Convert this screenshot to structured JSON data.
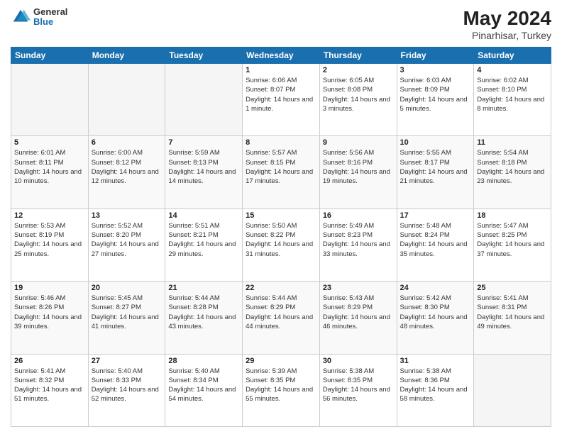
{
  "logo": {
    "general": "General",
    "blue": "Blue"
  },
  "title": "May 2024",
  "subtitle": "Pinarhisar, Turkey",
  "days_header": [
    "Sunday",
    "Monday",
    "Tuesday",
    "Wednesday",
    "Thursday",
    "Friday",
    "Saturday"
  ],
  "weeks": [
    {
      "shade": false,
      "days": [
        {
          "num": "",
          "empty": true,
          "info": ""
        },
        {
          "num": "",
          "empty": true,
          "info": ""
        },
        {
          "num": "",
          "empty": true,
          "info": ""
        },
        {
          "num": "1",
          "empty": false,
          "sunrise": "Sunrise: 6:06 AM",
          "sunset": "Sunset: 8:07 PM",
          "daylight": "Daylight: 14 hours and 1 minute."
        },
        {
          "num": "2",
          "empty": false,
          "sunrise": "Sunrise: 6:05 AM",
          "sunset": "Sunset: 8:08 PM",
          "daylight": "Daylight: 14 hours and 3 minutes."
        },
        {
          "num": "3",
          "empty": false,
          "sunrise": "Sunrise: 6:03 AM",
          "sunset": "Sunset: 8:09 PM",
          "daylight": "Daylight: 14 hours and 5 minutes."
        },
        {
          "num": "4",
          "empty": false,
          "sunrise": "Sunrise: 6:02 AM",
          "sunset": "Sunset: 8:10 PM",
          "daylight": "Daylight: 14 hours and 8 minutes."
        }
      ]
    },
    {
      "shade": true,
      "days": [
        {
          "num": "5",
          "empty": false,
          "sunrise": "Sunrise: 6:01 AM",
          "sunset": "Sunset: 8:11 PM",
          "daylight": "Daylight: 14 hours and 10 minutes."
        },
        {
          "num": "6",
          "empty": false,
          "sunrise": "Sunrise: 6:00 AM",
          "sunset": "Sunset: 8:12 PM",
          "daylight": "Daylight: 14 hours and 12 minutes."
        },
        {
          "num": "7",
          "empty": false,
          "sunrise": "Sunrise: 5:59 AM",
          "sunset": "Sunset: 8:13 PM",
          "daylight": "Daylight: 14 hours and 14 minutes."
        },
        {
          "num": "8",
          "empty": false,
          "sunrise": "Sunrise: 5:57 AM",
          "sunset": "Sunset: 8:15 PM",
          "daylight": "Daylight: 14 hours and 17 minutes."
        },
        {
          "num": "9",
          "empty": false,
          "sunrise": "Sunrise: 5:56 AM",
          "sunset": "Sunset: 8:16 PM",
          "daylight": "Daylight: 14 hours and 19 minutes."
        },
        {
          "num": "10",
          "empty": false,
          "sunrise": "Sunrise: 5:55 AM",
          "sunset": "Sunset: 8:17 PM",
          "daylight": "Daylight: 14 hours and 21 minutes."
        },
        {
          "num": "11",
          "empty": false,
          "sunrise": "Sunrise: 5:54 AM",
          "sunset": "Sunset: 8:18 PM",
          "daylight": "Daylight: 14 hours and 23 minutes."
        }
      ]
    },
    {
      "shade": false,
      "days": [
        {
          "num": "12",
          "empty": false,
          "sunrise": "Sunrise: 5:53 AM",
          "sunset": "Sunset: 8:19 PM",
          "daylight": "Daylight: 14 hours and 25 minutes."
        },
        {
          "num": "13",
          "empty": false,
          "sunrise": "Sunrise: 5:52 AM",
          "sunset": "Sunset: 8:20 PM",
          "daylight": "Daylight: 14 hours and 27 minutes."
        },
        {
          "num": "14",
          "empty": false,
          "sunrise": "Sunrise: 5:51 AM",
          "sunset": "Sunset: 8:21 PM",
          "daylight": "Daylight: 14 hours and 29 minutes."
        },
        {
          "num": "15",
          "empty": false,
          "sunrise": "Sunrise: 5:50 AM",
          "sunset": "Sunset: 8:22 PM",
          "daylight": "Daylight: 14 hours and 31 minutes."
        },
        {
          "num": "16",
          "empty": false,
          "sunrise": "Sunrise: 5:49 AM",
          "sunset": "Sunset: 8:23 PM",
          "daylight": "Daylight: 14 hours and 33 minutes."
        },
        {
          "num": "17",
          "empty": false,
          "sunrise": "Sunrise: 5:48 AM",
          "sunset": "Sunset: 8:24 PM",
          "daylight": "Daylight: 14 hours and 35 minutes."
        },
        {
          "num": "18",
          "empty": false,
          "sunrise": "Sunrise: 5:47 AM",
          "sunset": "Sunset: 8:25 PM",
          "daylight": "Daylight: 14 hours and 37 minutes."
        }
      ]
    },
    {
      "shade": true,
      "days": [
        {
          "num": "19",
          "empty": false,
          "sunrise": "Sunrise: 5:46 AM",
          "sunset": "Sunset: 8:26 PM",
          "daylight": "Daylight: 14 hours and 39 minutes."
        },
        {
          "num": "20",
          "empty": false,
          "sunrise": "Sunrise: 5:45 AM",
          "sunset": "Sunset: 8:27 PM",
          "daylight": "Daylight: 14 hours and 41 minutes."
        },
        {
          "num": "21",
          "empty": false,
          "sunrise": "Sunrise: 5:44 AM",
          "sunset": "Sunset: 8:28 PM",
          "daylight": "Daylight: 14 hours and 43 minutes."
        },
        {
          "num": "22",
          "empty": false,
          "sunrise": "Sunrise: 5:44 AM",
          "sunset": "Sunset: 8:29 PM",
          "daylight": "Daylight: 14 hours and 44 minutes."
        },
        {
          "num": "23",
          "empty": false,
          "sunrise": "Sunrise: 5:43 AM",
          "sunset": "Sunset: 8:29 PM",
          "daylight": "Daylight: 14 hours and 46 minutes."
        },
        {
          "num": "24",
          "empty": false,
          "sunrise": "Sunrise: 5:42 AM",
          "sunset": "Sunset: 8:30 PM",
          "daylight": "Daylight: 14 hours and 48 minutes."
        },
        {
          "num": "25",
          "empty": false,
          "sunrise": "Sunrise: 5:41 AM",
          "sunset": "Sunset: 8:31 PM",
          "daylight": "Daylight: 14 hours and 49 minutes."
        }
      ]
    },
    {
      "shade": false,
      "days": [
        {
          "num": "26",
          "empty": false,
          "sunrise": "Sunrise: 5:41 AM",
          "sunset": "Sunset: 8:32 PM",
          "daylight": "Daylight: 14 hours and 51 minutes."
        },
        {
          "num": "27",
          "empty": false,
          "sunrise": "Sunrise: 5:40 AM",
          "sunset": "Sunset: 8:33 PM",
          "daylight": "Daylight: 14 hours and 52 minutes."
        },
        {
          "num": "28",
          "empty": false,
          "sunrise": "Sunrise: 5:40 AM",
          "sunset": "Sunset: 8:34 PM",
          "daylight": "Daylight: 14 hours and 54 minutes."
        },
        {
          "num": "29",
          "empty": false,
          "sunrise": "Sunrise: 5:39 AM",
          "sunset": "Sunset: 8:35 PM",
          "daylight": "Daylight: 14 hours and 55 minutes."
        },
        {
          "num": "30",
          "empty": false,
          "sunrise": "Sunrise: 5:38 AM",
          "sunset": "Sunset: 8:35 PM",
          "daylight": "Daylight: 14 hours and 56 minutes."
        },
        {
          "num": "31",
          "empty": false,
          "sunrise": "Sunrise: 5:38 AM",
          "sunset": "Sunset: 8:36 PM",
          "daylight": "Daylight: 14 hours and 58 minutes."
        },
        {
          "num": "",
          "empty": true,
          "info": ""
        }
      ]
    }
  ]
}
